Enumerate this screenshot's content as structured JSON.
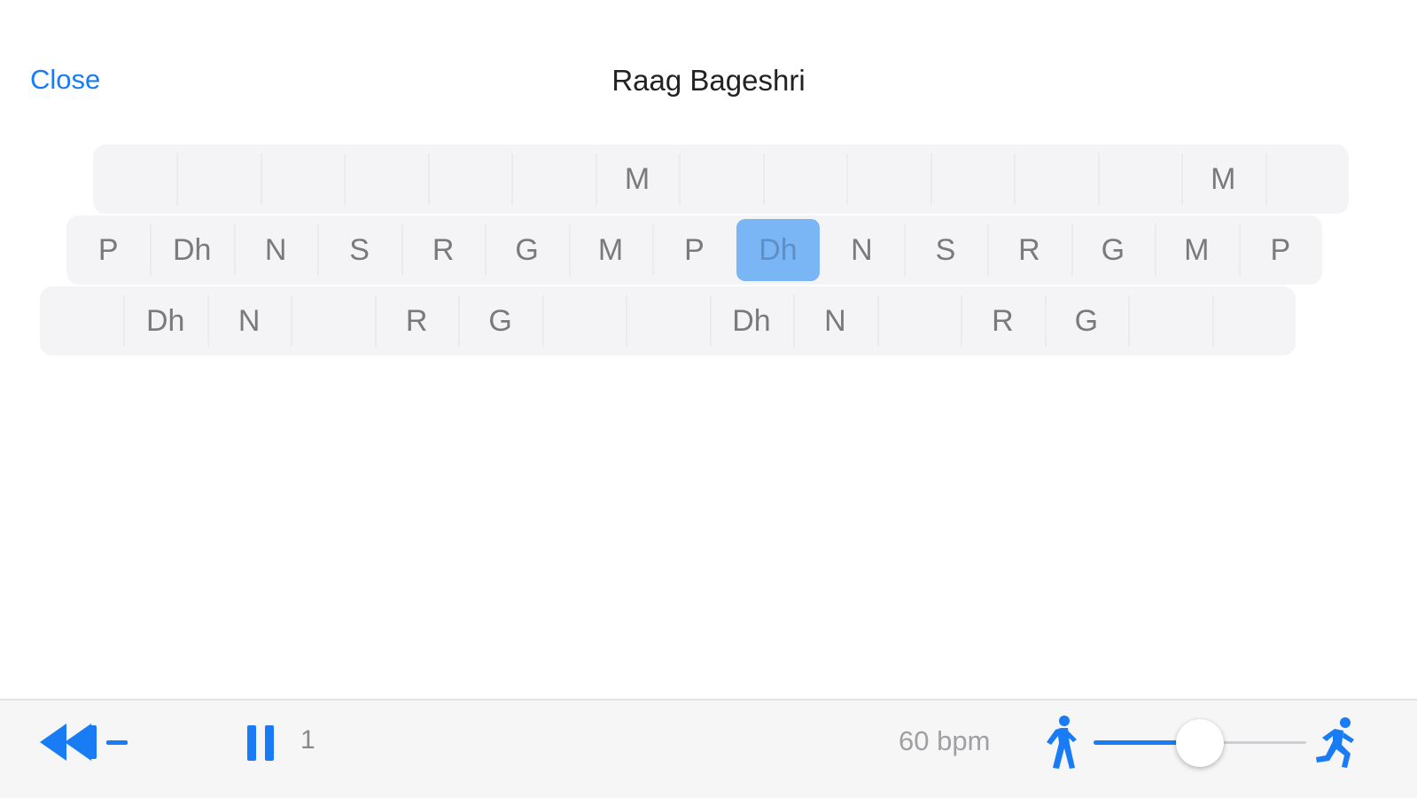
{
  "header": {
    "close_label": "Close",
    "title": "Raag Bageshri"
  },
  "note_rows": [
    [
      "",
      "",
      "",
      "",
      "",
      "",
      "M",
      "",
      "",
      "",
      "",
      "",
      "",
      "M",
      ""
    ],
    [
      "P",
      "Dh",
      "N",
      "S",
      "R",
      "G",
      "M",
      "P",
      "Dh",
      "N",
      "S",
      "R",
      "G",
      "M",
      "P"
    ],
    [
      "",
      "Dh",
      "N",
      "",
      "R",
      "G",
      "",
      "",
      "Dh",
      "N",
      "",
      "R",
      "G",
      "",
      ""
    ]
  ],
  "active_note": {
    "row": 1,
    "column": 8
  },
  "toolbar": {
    "beat_count": "1",
    "tempo_label": "60 bpm",
    "tempo_slider_fraction": 0.5,
    "icons": [
      "rewind-icon",
      "minus-icon",
      "pause-icon",
      "walk-icon",
      "run-icon"
    ]
  },
  "colors": {
    "accent": "#1a7cf5",
    "active_cell": "#7ab6f6",
    "row_background": "#f4f4f6",
    "note_text": "#7a7a7a"
  }
}
